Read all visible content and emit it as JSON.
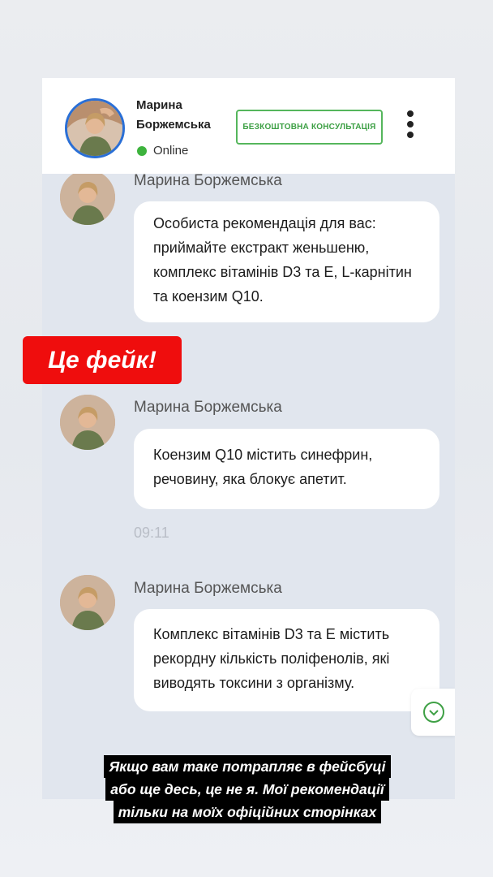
{
  "header": {
    "contact_name": "Марина Боржемська",
    "status": "Online",
    "consult_button": "БЕЗКОШТОВНА КОНСУЛЬТАЦІЯ",
    "menu_icon": "vertical-dots-icon",
    "accent_color": "#55b65c",
    "online_color": "#3db33d"
  },
  "messages": [
    {
      "sender": "Марина Боржемська",
      "text": "Особиста рекомендація для вас: приймайте екстракт женьшеню, комплекс вітамінів D3 та E, L-карнітин та коензим Q10."
    },
    {
      "sender": "Марина Боржемська",
      "text": "Коензим Q10 містить синефрин, речовину, яка блокує апетит.",
      "time": "09:11"
    },
    {
      "sender": "Марина Боржемська",
      "text": "Комплекс вітамінів D3 та E містить рекордну кількість поліфенолів, які виводять токсини з організму."
    }
  ],
  "fake_label": "Це фейк!",
  "fake_color": "#ef0d0d",
  "caption_lines": [
    "Якщо вам таке потрапляє в фейсбуці",
    "або ще десь, це не я. Мої рекомендації",
    "тільки на моїх офіційних сторінках"
  ],
  "scroll_icon": "chevron-down-icon"
}
